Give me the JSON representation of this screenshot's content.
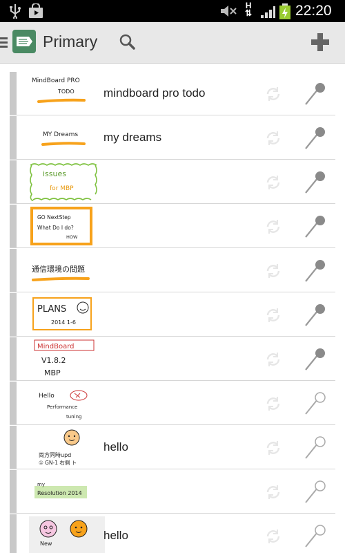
{
  "status_bar": {
    "time": "22:20",
    "network_type": "H",
    "icons": [
      "usb-icon",
      "shopping-bag-icon",
      "mute-icon",
      "signal-icon",
      "battery-charging-icon"
    ]
  },
  "action_bar": {
    "title": "Primary",
    "icons": [
      "menu-icon",
      "app-logo-icon",
      "search-icon",
      "add-icon"
    ]
  },
  "notes": [
    {
      "title": "mindboard pro todo",
      "thumb_lines": [
        "MindBoard PRO",
        "TODO"
      ],
      "pinned": true,
      "colors": {
        "accent": "#f7a21b"
      }
    },
    {
      "title": "my dreams",
      "thumb_lines": [
        "MY Dreams"
      ],
      "pinned": true
    },
    {
      "title": "",
      "thumb_lines": [
        "issues",
        "for MBP"
      ],
      "pinned": true
    },
    {
      "title": "",
      "thumb_lines": [
        "GO NextStep",
        "What Do I do?",
        "HOW"
      ],
      "pinned": true
    },
    {
      "title": "",
      "thumb_lines": [
        "通信環境の問題"
      ],
      "pinned": true
    },
    {
      "title": "",
      "thumb_lines": [
        "PLANS",
        "2014 1-6"
      ],
      "pinned": true
    },
    {
      "title": "",
      "thumb_lines": [
        "MindBoard",
        "V1.8.2",
        "MBP"
      ],
      "pinned": true
    },
    {
      "title": "",
      "thumb_lines": [
        "Hello",
        "Performance",
        "tuning"
      ],
      "pinned": false
    },
    {
      "title": "hello",
      "thumb_lines": [
        "両方同時upd",
        "① GN-1 右側 ト"
      ],
      "pinned": false
    },
    {
      "title": "",
      "thumb_lines": [
        "my",
        "Resolution 2014"
      ],
      "pinned": false
    },
    {
      "title": "hello",
      "thumb_lines": [
        "New"
      ],
      "pinned": false
    }
  ],
  "colors": {
    "accent_orange": "#f7a21b",
    "leaf_green": "#7fc241",
    "app_green": "#4a8a63",
    "resolution_green": "#cde8b0"
  }
}
